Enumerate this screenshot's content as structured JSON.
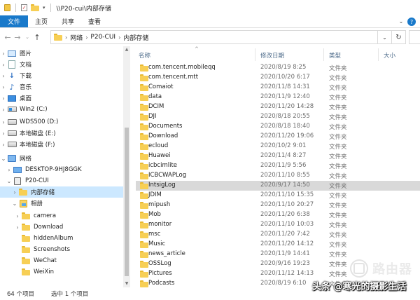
{
  "window": {
    "title": "\\\\P20-cui\\内部存储"
  },
  "ribbon": {
    "tabs": [
      "文件",
      "主页",
      "共享",
      "查看"
    ],
    "help_glyph": "?"
  },
  "address": {
    "crumbs": [
      "网络",
      "P20-CUI",
      "内部存储"
    ],
    "refresh_glyph": "↻"
  },
  "nav": {
    "items": [
      {
        "label": "图片",
        "icon": "pictures-icon"
      },
      {
        "label": "文档",
        "icon": "documents-icon"
      },
      {
        "label": "下载",
        "icon": "downloads-icon"
      },
      {
        "label": "音乐",
        "icon": "music-icon"
      },
      {
        "label": "桌面",
        "icon": "desktop-icon"
      },
      {
        "label": "Win2 (C:)",
        "icon": "windows-drive-icon"
      },
      {
        "label": "WDS500 (D:)",
        "icon": "drive-icon"
      },
      {
        "label": "本地磁盘 (E:)",
        "icon": "drive-icon"
      },
      {
        "label": "本地磁盘 (F:)",
        "icon": "drive-icon"
      },
      {
        "label": "网络",
        "icon": "network-icon"
      },
      {
        "label": "DESKTOP-9HJ8GGK",
        "icon": "computer-icon"
      },
      {
        "label": "P20-CUI",
        "icon": "phone-icon"
      },
      {
        "label": "内部存储",
        "icon": "folder-icon"
      },
      {
        "label": "相册",
        "icon": "album-icon"
      },
      {
        "label": "camera",
        "icon": "folder-icon"
      },
      {
        "label": "Download",
        "icon": "folder-icon"
      },
      {
        "label": "hiddenAlbum",
        "icon": "folder-icon"
      },
      {
        "label": "Screenshots",
        "icon": "folder-icon"
      },
      {
        "label": "WeChat",
        "icon": "folder-icon"
      },
      {
        "label": "WeiXin",
        "icon": "folder-icon"
      }
    ]
  },
  "columns": {
    "name": "名称",
    "date": "修改日期",
    "type": "类型",
    "size": "大小"
  },
  "files": [
    {
      "name": "com.tencent.mobileqq",
      "date": "2020/8/19 8:25",
      "type": "文件夹"
    },
    {
      "name": "com.tencent.mtt",
      "date": "2020/10/20 6:17",
      "type": "文件夹"
    },
    {
      "name": "Comaiot",
      "date": "2020/11/8 14:31",
      "type": "文件夹"
    },
    {
      "name": "data",
      "date": "2020/11/9 12:40",
      "type": "文件夹"
    },
    {
      "name": "DCIM",
      "date": "2020/11/20 14:28",
      "type": "文件夹"
    },
    {
      "name": "DJI",
      "date": "2020/8/18 20:55",
      "type": "文件夹"
    },
    {
      "name": "Documents",
      "date": "2020/8/18 18:40",
      "type": "文件夹"
    },
    {
      "name": "Download",
      "date": "2020/11/20 19:06",
      "type": "文件夹"
    },
    {
      "name": "ecloud",
      "date": "2020/10/2 9:01",
      "type": "文件夹"
    },
    {
      "name": "Huawei",
      "date": "2020/11/4 8:27",
      "type": "文件夹"
    },
    {
      "name": "icbcimlite",
      "date": "2020/11/9 5:56",
      "type": "文件夹"
    },
    {
      "name": "ICBCWAPLog",
      "date": "2020/11/10 8:55",
      "type": "文件夹"
    },
    {
      "name": "IntsigLog",
      "date": "2020/9/17 14:50",
      "type": "文件夹"
    },
    {
      "name": "JDIM",
      "date": "2020/11/10 15:35",
      "type": "文件夹"
    },
    {
      "name": "mipush",
      "date": "2020/11/10 20:27",
      "type": "文件夹"
    },
    {
      "name": "Mob",
      "date": "2020/11/20 6:38",
      "type": "文件夹"
    },
    {
      "name": "monitor",
      "date": "2020/11/10 10:03",
      "type": "文件夹"
    },
    {
      "name": "msc",
      "date": "2020/11/20 7:42",
      "type": "文件夹"
    },
    {
      "name": "Music",
      "date": "2020/11/20 14:12",
      "type": "文件夹"
    },
    {
      "name": "news_article",
      "date": "2020/11/9 14:41",
      "type": "文件夹"
    },
    {
      "name": "OSSLog",
      "date": "2020/9/16 19:23",
      "type": "文件夹"
    },
    {
      "name": "Pictures",
      "date": "2020/11/12 14:13",
      "type": "文件夹"
    },
    {
      "name": "Podcasts",
      "date": "2020/8/19 6:10",
      "type": "文件夹"
    }
  ],
  "status": {
    "count": "64 个项目",
    "selected": "选中 1 个项目"
  },
  "watermark": {
    "brand": "路由器",
    "line": "头条 @寒光的摄影生活"
  }
}
